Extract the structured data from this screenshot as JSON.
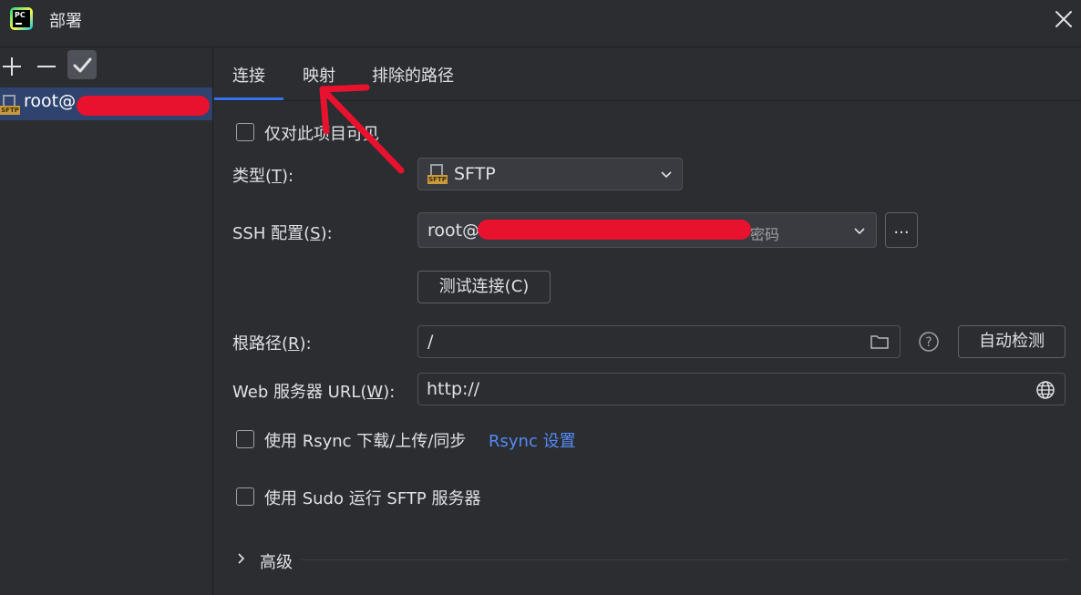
{
  "window": {
    "title": "部署",
    "app_icon_text": "PC"
  },
  "sidebar": {
    "server_label": "root@",
    "server_icon_tag": "SFTP"
  },
  "tabs": [
    {
      "label": "连接"
    },
    {
      "label": "映射"
    },
    {
      "label": "排除的路径"
    }
  ],
  "form": {
    "visible_only_project": "仅对此项目可见",
    "type_label_prefix": "类型(",
    "type_label_key": "T",
    "type_label_suffix": "):",
    "type_value": "SFTP",
    "ssh_label_prefix": "SSH 配置(",
    "ssh_label_key": "S",
    "ssh_label_suffix": "):",
    "ssh_value": "root@",
    "ssh_value_tail": "密码",
    "ssh_more_button": "...",
    "test_connection_button": "测试连接(C)",
    "root_path_label_prefix": "根路径(",
    "root_path_label_key": "R",
    "root_path_label_suffix": "):",
    "root_path_value": "/",
    "autodetect_button": "自动检测",
    "web_url_label_prefix": "Web 服务器 URL(",
    "web_url_label_key": "W",
    "web_url_label_suffix": "):",
    "web_url_value": "http://",
    "rsync_checkbox_label": "使用 Rsync 下载/上传/同步",
    "rsync_settings_link": "Rsync 设置",
    "sudo_checkbox_label": "使用 Sudo 运行 SFTP 服务器",
    "advanced_label": "高级"
  },
  "colors": {
    "accent": "#3574f0",
    "link": "#548af7",
    "selection": "#2e436e",
    "annotation": "#e8122f"
  }
}
